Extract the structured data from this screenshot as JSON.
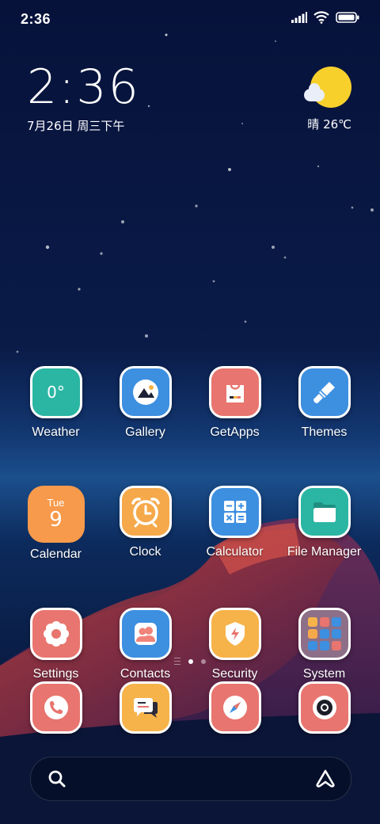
{
  "status_bar": {
    "time": "2:36",
    "icons": [
      "signal-icon",
      "wifi-icon",
      "battery-icon"
    ]
  },
  "clock_widget": {
    "time": "2:36",
    "date": "7月26日 周三下午"
  },
  "weather_widget": {
    "icon": "sunny-cloud-icon",
    "text": "晴 26℃"
  },
  "apps": [
    {
      "label": "Weather",
      "icon": "weather-icon",
      "color": "#2bb6a3",
      "text": "0°"
    },
    {
      "label": "Gallery",
      "icon": "gallery-icon",
      "color": "#3d8fe0"
    },
    {
      "label": "GetApps",
      "icon": "getapps-icon",
      "color": "#e8756f"
    },
    {
      "label": "Themes",
      "icon": "themes-icon",
      "color": "#3d8fe0"
    },
    {
      "label": "Calendar",
      "icon": "calendar-icon",
      "color": "#f79a4b",
      "day": "Tue",
      "date": "9"
    },
    {
      "label": "Clock",
      "icon": "clock-icon",
      "color": "#f6a94a"
    },
    {
      "label": "Calculator",
      "icon": "calculator-icon",
      "color": "#3d8fe0"
    },
    {
      "label": "File Manager",
      "icon": "folder-icon",
      "color": "#2bb6a3"
    },
    {
      "label": "Settings",
      "icon": "settings-icon",
      "color": "#e8756f"
    },
    {
      "label": "Contacts",
      "icon": "contacts-icon",
      "color": "#3d8fe0"
    },
    {
      "label": "Security",
      "icon": "security-icon",
      "color": "#f6b34a"
    },
    {
      "label": "System",
      "icon": "system-folder-icon",
      "color": "#8d6f88"
    }
  ],
  "dock": [
    {
      "icon": "phone-icon",
      "color": "#e8756f"
    },
    {
      "icon": "messaging-icon",
      "color": "#f6b34a"
    },
    {
      "icon": "browser-icon",
      "color": "#e8756f"
    },
    {
      "icon": "camera-icon",
      "color": "#e8756f"
    }
  ],
  "page_indicator": {
    "pages": 2,
    "active": 1
  },
  "search_bar": {
    "left_icon": "search-icon",
    "right_icon": "assistant-icon"
  }
}
